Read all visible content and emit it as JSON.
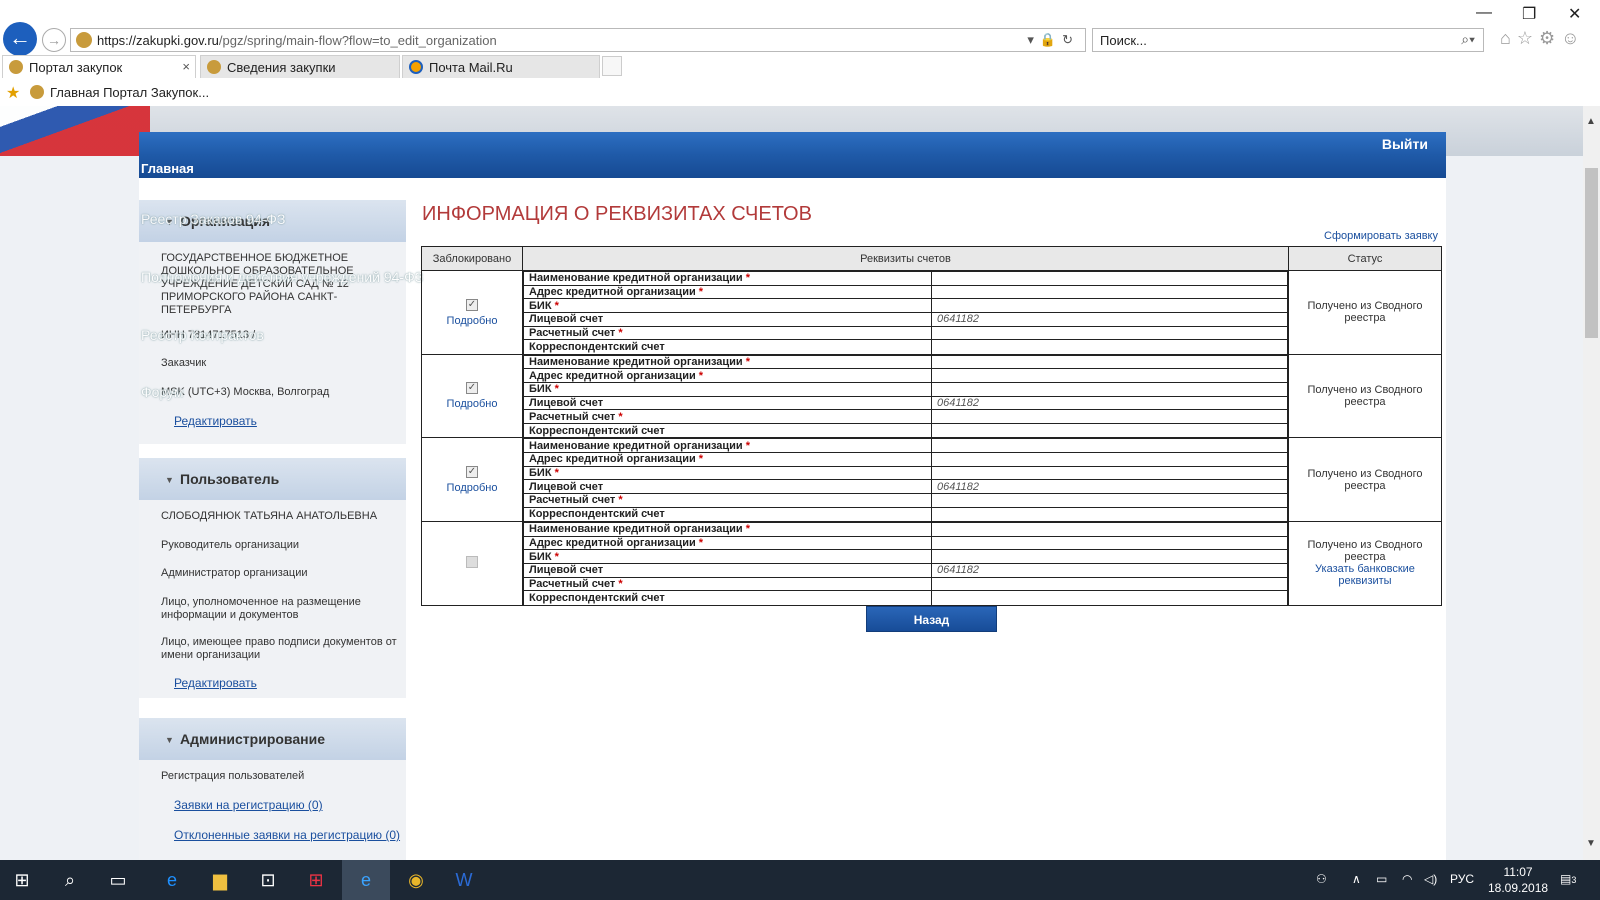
{
  "browser": {
    "url_main": "https://zakupki.gov.ru",
    "url_rest": "/pgz/spring/main-flow?flow=to_edit_organization",
    "search_placeholder": "Поиск...",
    "tabs": [
      {
        "label": "Портал закупок",
        "close": "×"
      },
      {
        "label": "Сведения закупки"
      },
      {
        "label": "Почта Mail.Ru"
      }
    ],
    "favorite": "Главная Портал Закупок..."
  },
  "header": {
    "logout": "Выйти",
    "home": "Главная"
  },
  "ghost_menu": [
    "Реестр Заказов 94-ФЗ",
    "Полномочия и действия учреждений 94-ФЗ",
    "Реестр Контрактов",
    "Форум"
  ],
  "sidebar": {
    "org": {
      "title": "Организация",
      "name": "ГОСУДАРСТВЕННОЕ БЮДЖЕТНОЕ ДОШКОЛЬНОЕ ОБРАЗОВАТЕЛЬНОЕ УЧРЕЖДЕНИЕ ДЕТСКИЙ САД № 12 ПРИМОРСКОГО РАЙОНА САНКТ-ПЕТЕРБУРГА",
      "inn": "ИНН 7814717513 /",
      "role": "Заказчик",
      "tz": "MSK (UTC+3) Москва, Волгоград",
      "edit": "Редактировать"
    },
    "user": {
      "title": "Пользователь",
      "name": "СЛОБОДЯНЮК ТАТЬЯНА АНАТОЛЬЕВНА",
      "roles": [
        "Руководитель организации",
        "Администратор организации",
        "Лицо, уполномоченное на размещение информации и документов",
        "Лицо, имеющее право подписи документов от имени организации"
      ],
      "edit": "Редактировать"
    },
    "admin": {
      "title": "Администрирование",
      "reg": "Регистрация пользователей",
      "requests": "Заявки на регистрацию (0)",
      "rejected": "Отклоненные заявки на регистрацию (0)"
    }
  },
  "main": {
    "title": "ИНФОРМАЦИЯ О РЕКВИЗИТАХ СЧЕТОВ",
    "form_request": "Сформировать заявку",
    "columns": [
      "Заблокировано",
      "Реквизиты счетов",
      "Статус"
    ],
    "field_labels": [
      "Наименование кредитной организации",
      "Адрес кредитной организации",
      "БИК",
      "Лицевой счет",
      "Расчетный счет",
      "Корреспондентский счет"
    ],
    "required_mark": "*",
    "more": "Подробно",
    "accounts": [
      {
        "locked": true,
        "values": [
          "",
          "",
          "",
          "0641182",
          "",
          ""
        ],
        "status": "Получено из Сводного реестра",
        "action": ""
      },
      {
        "locked": true,
        "values": [
          "",
          "",
          "",
          "0641182",
          "",
          ""
        ],
        "status": "Получено из Сводного реестра",
        "action": ""
      },
      {
        "locked": true,
        "values": [
          "",
          "",
          "",
          "0641182",
          "",
          ""
        ],
        "status": "Получено из Сводного реестра",
        "action": ""
      },
      {
        "locked": false,
        "values": [
          "",
          "",
          "",
          "0641182",
          "",
          ""
        ],
        "status": "Получено из Сводного реестра",
        "action": "Указать банковские реквизиты"
      }
    ],
    "back_button": "Назад"
  },
  "taskbar": {
    "lang": "РУС",
    "time": "11:07",
    "date": "18.09.2018",
    "notifications": "3"
  }
}
